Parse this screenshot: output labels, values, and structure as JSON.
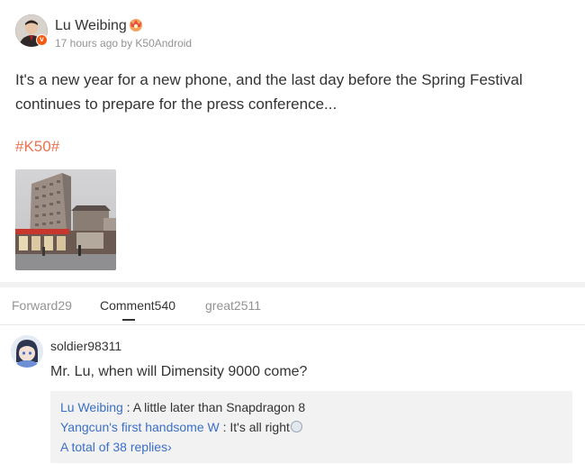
{
  "post": {
    "author": "Lu Weibing",
    "author_badge_icon": "vip-crown-icon",
    "time_source": "17 hours ago by K50Android",
    "text_line1": "It's a new year for a new phone, and the last day before the Spring Festival",
    "text_line2": "continues to prepare for the press conference...",
    "hashtag": "#K50#",
    "photo": "street-building-photo"
  },
  "tabs": [
    {
      "label": "Forward29",
      "active": false
    },
    {
      "label": "Comment540",
      "active": true
    },
    {
      "label": "great2511",
      "active": false
    }
  ],
  "comment": {
    "user": "soldier98311",
    "text": "Mr. Lu, when will Dimensity 9000 come?",
    "replies": [
      {
        "name": "Lu Weibing",
        "sep": " : ",
        "text": "A little later than Snapdragon 8"
      },
      {
        "name": "Yangcun's first handsome W",
        "sep": " : ",
        "text": "It's all right"
      }
    ],
    "total_replies": "A total of 38 replies",
    "total_chevron": "›"
  },
  "colors": {
    "link_blue": "#3b6fc7",
    "hashtag_orange": "#eb7350",
    "muted_gray": "#939393",
    "reply_bg": "#f2f2f2"
  }
}
